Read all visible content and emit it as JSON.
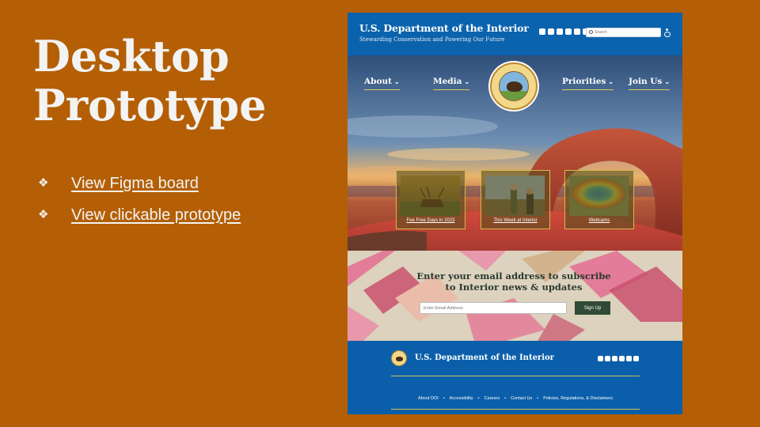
{
  "slide": {
    "title_line1": "Desktop",
    "title_line2": "Prototype",
    "links": [
      "View Figma board",
      "View clickable prototype"
    ]
  },
  "prototype": {
    "header": {
      "title": "U.S. Department of the Interior",
      "subtitle": "Stewarding Conservation and Powering Our Future",
      "search_placeholder": "Search",
      "social_icons": [
        "youtube-icon",
        "twitter-icon",
        "facebook-icon",
        "instagram-icon",
        "tumblr-icon",
        "flickr-icon"
      ]
    },
    "nav": [
      {
        "label": "About"
      },
      {
        "label": "Media"
      },
      {
        "label": "Priorities"
      },
      {
        "label": "Join Us"
      }
    ],
    "cards": [
      {
        "label": "Fee Free Days in 2023"
      },
      {
        "label": "This Week at Interior"
      },
      {
        "label": "Webcams"
      }
    ],
    "newsletter": {
      "heading_line1": "Enter your email address to subscribe",
      "heading_line2": "to Interior news & updates",
      "email_placeholder": "Enter Email Address",
      "button": "Sign Up"
    },
    "footer": {
      "title": "U.S. Department of the Interior",
      "links": [
        "About DOI",
        "Accessibility",
        "Careers",
        "Contact Us",
        "Policies, Regulations, & Disclaimers"
      ],
      "separator": "•"
    }
  },
  "colors": {
    "slide_bg": "#b45f06",
    "header_blue": "#0b63ad",
    "accent_gold": "#e1c85a",
    "signup_green": "#2f4a36"
  }
}
